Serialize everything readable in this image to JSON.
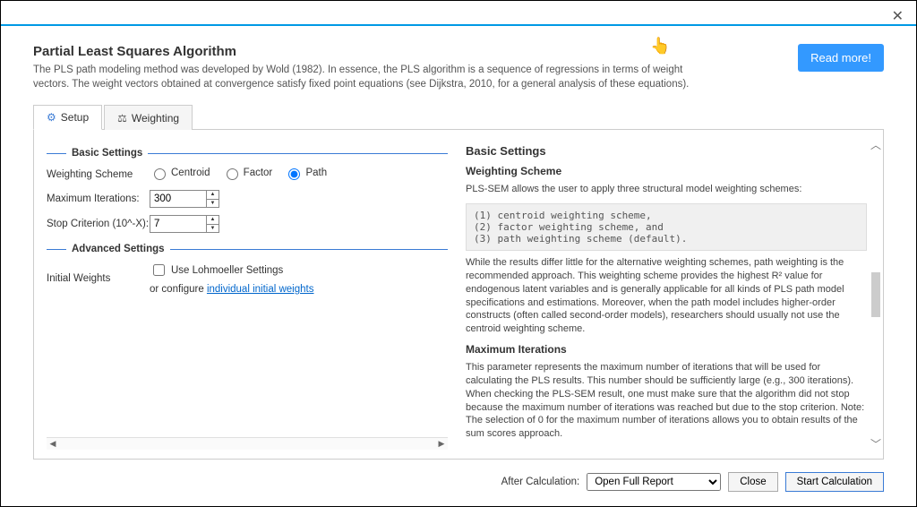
{
  "header": {
    "title": "Partial Least Squares Algorithm",
    "description": "The PLS path modeling method was developed by Wold (1982). In essence, the PLS algorithm is a sequence of regressions in terms of weight vectors. The weight vectors obtained at convergence satisfy fixed point equations (see Dijkstra, 2010, for a general analysis of these equations).",
    "read_more": "Read more!"
  },
  "tabs": {
    "setup": "Setup",
    "weighting": "Weighting"
  },
  "basic": {
    "section": "Basic Settings",
    "weighting_scheme_label": "Weighting Scheme",
    "opt_centroid": "Centroid",
    "opt_factor": "Factor",
    "opt_path": "Path",
    "max_iter_label": "Maximum Iterations:",
    "max_iter_value": "300",
    "stop_crit_label": "Stop Criterion (10^-X):",
    "stop_crit_value": "7"
  },
  "advanced": {
    "section": "Advanced Settings",
    "initial_weights_label": "Initial Weights",
    "lohmoeller_label": "Use Lohmoeller Settings",
    "configure_prefix": "or configure ",
    "configure_link": "individual initial weights"
  },
  "info": {
    "h_basic": "Basic Settings",
    "h_ws": "Weighting Scheme",
    "ws_intro": "PLS-SEM allows the user to apply three structural model weighting schemes:",
    "ws_code": "(1) centroid weighting scheme,\n(2) factor weighting scheme, and\n(3) path weighting scheme (default).",
    "ws_body": "While the results differ little for the alternative weighting schemes, path weighting is the recommended approach. This weighting scheme provides the highest R² value for endogenous latent variables and is generally applicable for all kinds of PLS path model specifications and estimations. Moreover, when the path model includes higher-order constructs (often called second-order models), researchers should usually not use the centroid weighting scheme.",
    "h_mi": "Maximum Iterations",
    "mi_body": "This parameter represents the maximum number of iterations that will be used for calculating the PLS results. This number should be sufficiently large (e.g., 300 iterations). When checking the PLS-SEM result, one must make sure that the algorithm did not stop because the maximum number of iterations was reached but due to the stop criterion. Note: The selection of 0 for the maximum number of iterations allows you to obtain results of the sum scores approach."
  },
  "footer": {
    "after_label": "After Calculation:",
    "after_value": "Open Full Report",
    "close": "Close",
    "start": "Start Calculation"
  }
}
